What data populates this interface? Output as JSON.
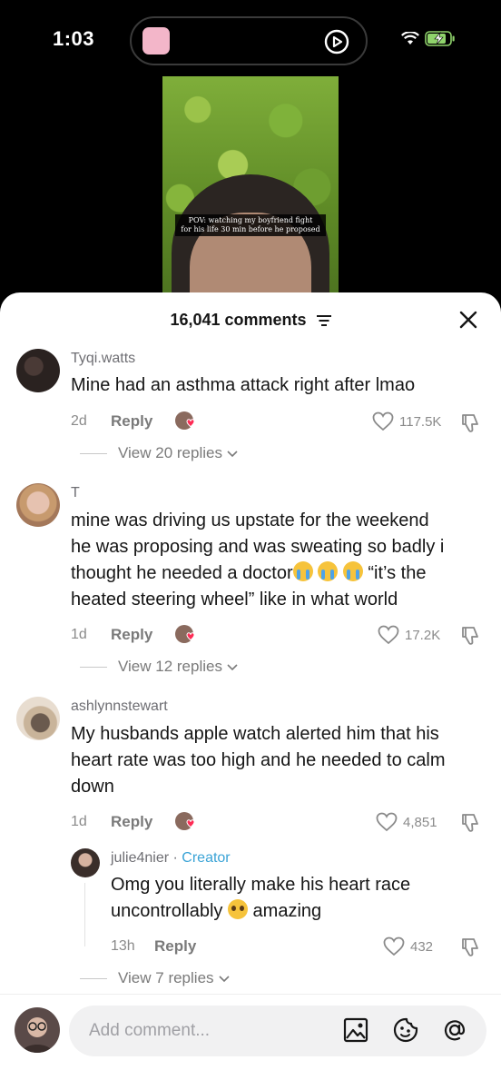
{
  "status_bar": {
    "time": "1:03"
  },
  "video": {
    "caption_line1": "POV: watching my boyfriend fight",
    "caption_line2": "for his life 30 min before he proposed"
  },
  "header": {
    "comment_count": "16,041 comments"
  },
  "comments": [
    {
      "username": "Tyqi.watts",
      "text": "Mine had an asthma attack right after lmao",
      "age": "2d",
      "reply_label": "Reply",
      "likes": "117.5K",
      "view_replies": "View 20 replies"
    },
    {
      "username": "T",
      "text_lines": [
        "mine was driving us upstate for the weekend",
        "he was proposing and was sweating so badly i",
        "thought he needed a doctor",
        "“it’s the",
        "heated steering wheel” like in what world"
      ],
      "age": "1d",
      "reply_label": "Reply",
      "likes": "17.2K",
      "view_replies": "View 12 replies"
    },
    {
      "username": "ashlynnstewart",
      "text_lines": [
        "My husbands apple watch alerted him that his",
        "heart rate was too high and he needed to calm",
        "down"
      ],
      "age": "1d",
      "reply_label": "Reply",
      "likes": "4,851",
      "reply": {
        "username": "julie4nier",
        "separator": "·",
        "creator_label": "Creator",
        "text_line1": "Omg you literally make his heart race",
        "text_line2a": "uncontrollably",
        "text_line2b": "amazing",
        "age": "13h",
        "reply_label": "Reply",
        "likes": "432"
      },
      "view_replies": "View 7 replies"
    }
  ],
  "composer": {
    "placeholder": "Add comment..."
  },
  "colors": {
    "accent_creator": "#3aa3d6",
    "like_heart": "#fe2c55"
  },
  "icons": [
    "filter-icon",
    "close-icon",
    "heart-icon",
    "dislike-icon",
    "chevron-down-icon",
    "image-icon",
    "emoji-icon",
    "mention-icon",
    "wifi-icon",
    "battery-icon",
    "play-icon"
  ]
}
